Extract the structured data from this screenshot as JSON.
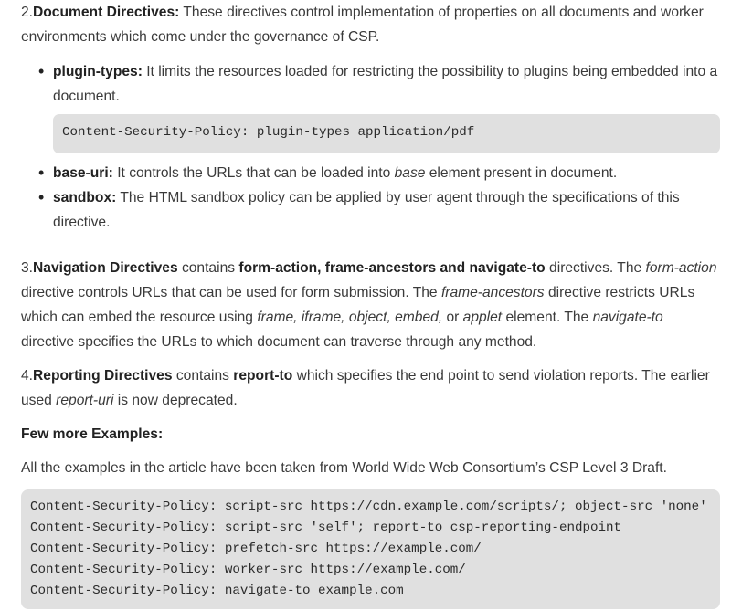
{
  "section2": {
    "number": "2.",
    "title": "Document Directives:",
    "text": " These directives control implementation of properties on all documents and worker environments which come under the governance of CSP.",
    "items": [
      {
        "term": "plugin-types:",
        "text": " It limits the resources loaded for restricting the possibility to plugins being embedded into a document.",
        "code": "Content-Security-Policy: plugin-types application/pdf"
      },
      {
        "term": "base-uri:",
        "text_before": " It controls the URLs that can be loaded into ",
        "italic": "base",
        "text_after": " element present in document."
      },
      {
        "term": "sandbox:",
        "text": " The HTML sandbox policy can be applied by user agent through the specifications of this directive."
      }
    ]
  },
  "section3": {
    "number": "3.",
    "title": "Navigation Directives",
    "t1": " contains ",
    "bold2": "form-action, frame-ancestors and navigate-to",
    "t2": " directives. The ",
    "i1": "form-action",
    "t3": " directive controls URLs that can be used for form submission. The ",
    "i2": "frame-ancestors",
    "t4": " directive restricts URLs which can embed the resource using ",
    "i3": "frame, iframe, object, embed,",
    "t5": " or ",
    "i4": "applet",
    "t6": " element. The ",
    "i5": "navigate-to",
    "t7": " directive specifies the URLs to which document can traverse through any method."
  },
  "section4": {
    "number": "4.",
    "title": "Reporting Directives",
    "t1": " contains ",
    "bold2": "report-to",
    "t2": " which specifies the end point to send violation reports. The earlier used ",
    "i1": "report-uri",
    "t3": " is now deprecated."
  },
  "examples": {
    "heading": "Few more Examples:",
    "intro": "All the examples in the article have been taken from World Wide Web Consortium’s CSP Level 3 Draft.",
    "code_lines": [
      "Content-Security-Policy: script-src https://cdn.example.com/scripts/; object-src 'none'",
      "Content-Security-Policy: script-src 'self'; report-to csp-reporting-endpoint",
      "Content-Security-Policy: prefetch-src https://example.com/",
      "Content-Security-Policy: worker-src https://example.com/",
      "Content-Security-Policy: navigate-to example.com"
    ]
  }
}
